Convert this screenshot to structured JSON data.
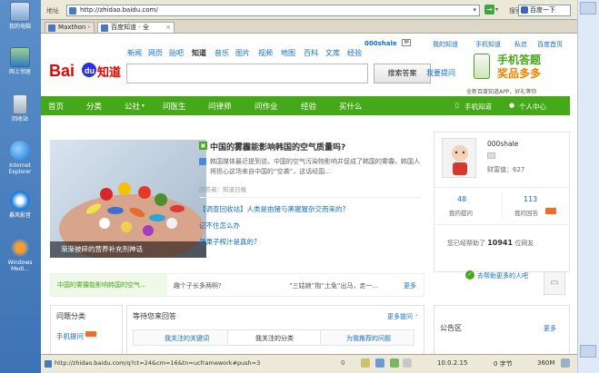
{
  "desktop": {
    "icons": [
      {
        "label": "我的电脑"
      },
      {
        "label": "网上邻居"
      },
      {
        "label": "回收站"
      },
      {
        "label": "Internet Explorer"
      },
      {
        "label": "暴风影音"
      },
      {
        "label": "Windows Medi..."
      }
    ]
  },
  "toolbar": {
    "address_label": "地址",
    "url": "http://zhidao.baidu.com/",
    "search_label": "搜索",
    "search_value": "百度一下"
  },
  "tabs": [
    {
      "label": "Maxthon -"
    },
    {
      "label": "百度知道 - 全"
    }
  ],
  "baidu": {
    "top_links": [
      "新闻",
      "网页",
      "贴吧",
      "知道",
      "音乐",
      "图片",
      "视频",
      "地图",
      "百科",
      "文库",
      "经验"
    ],
    "user": "000shale",
    "user_links": [
      "我的知道",
      "手机知道",
      "私信",
      "百度首页"
    ],
    "search_button": "搜索答案",
    "ask_link": "我要提问",
    "banner_title": "手机答题",
    "banner_sub": "奖品多多",
    "banner_caption": "全新百度知道APP，好礼等你",
    "nav": [
      "首页",
      "分类",
      "公社",
      "问医生",
      "问律师",
      "问作业",
      "经验",
      "买什么"
    ],
    "nav_right": [
      "手机知道",
      "个人中心"
    ],
    "feature_caption": "渐渐被碎的营养补充剂神话",
    "hot_title": "中国的雾霾能影响韩国的空气质量吗?",
    "hot_summary": "韩国媒体最近提到说，中国的空气污染物影响并促成了韩国的雾霾，韩国人将担心这场来自中国的“空袭”，这话经国...",
    "hot_source": "回答者：知道日报",
    "more_items": [
      "【调查回收站】人类是由猪与黑猩猩杂交而来的?",
      "记不住怎么办",
      "悲果子榨汁是真的?"
    ],
    "profile_name": "000shale",
    "profile_wealth": "财富值：627",
    "stats": [
      {
        "value": "48",
        "label": "我的提问"
      },
      {
        "value": "113",
        "label": "我的回答"
      }
    ],
    "help_text_pre": "您已经帮助了",
    "help_count": "10941",
    "help_text_post": "位网友",
    "more_help": "去帮助更多的人吧",
    "ticker": [
      "中国的雾霾能影响韩国的空气...",
      "趣个子长多两啊?",
      "“三姑娘”抱“土兔”出马，走一..."
    ],
    "ticker_more": "更多",
    "categories_title": "问题分类",
    "categories_first": "手机提问",
    "waiting_title": "等待您来回答",
    "waiting_more": "更多提问",
    "waiting_tabs": [
      "我关注的关键词",
      "我关注的分类",
      "为我推荐的问题"
    ],
    "notice_title": "公告区",
    "notice_more": "更多"
  },
  "status": {
    "url": "http://zhidao.baidu.com/q?ct=24&cm=16&tn=ucframework#push=3",
    "zoom": "10.0.2.15",
    "bytes": "0 字节",
    "percent": "360M"
  }
}
